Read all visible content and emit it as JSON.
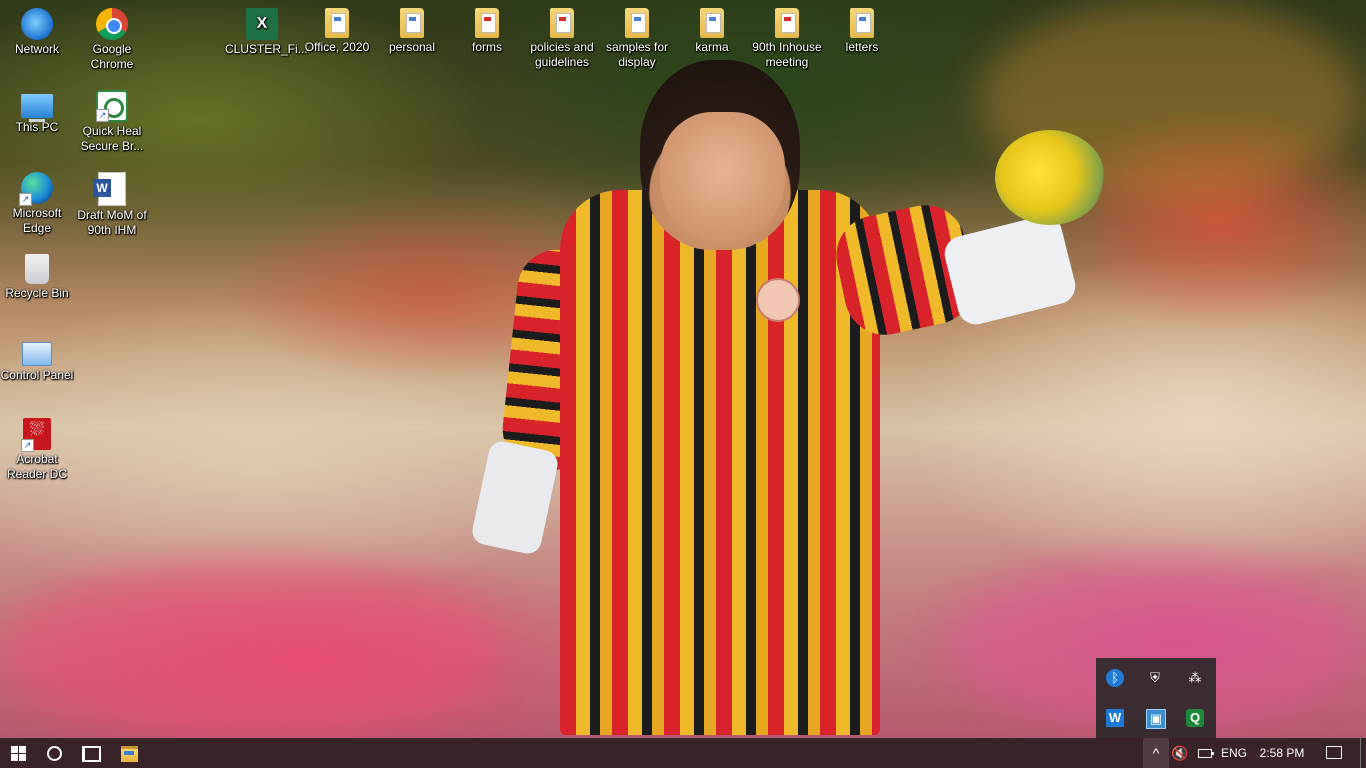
{
  "desktop": {
    "icons_left_col1": [
      {
        "label": "Network",
        "icon": "network-icon"
      },
      {
        "label": "This PC",
        "icon": "computer-icon"
      },
      {
        "label": "Microsoft Edge",
        "icon": "edge-icon"
      },
      {
        "label": "Recycle Bin",
        "icon": "recycle-bin-icon"
      },
      {
        "label": "Control Panel",
        "icon": "control-panel-icon"
      },
      {
        "label": "Acrobat Reader DC",
        "icon": "acrobat-icon"
      }
    ],
    "icons_left_col2": [
      {
        "label": "Google Chrome",
        "icon": "chrome-icon"
      },
      {
        "label": "Quick Heal Secure Br...",
        "icon": "quick-heal-icon"
      },
      {
        "label": "Draft MoM of 90th IHM",
        "icon": "word-document-icon"
      }
    ],
    "icons_top_row": [
      {
        "label": "CLUSTER_Fi...",
        "icon": "excel-file-icon"
      },
      {
        "label": "Office, 2020",
        "icon": "folder-icon"
      },
      {
        "label": "personal",
        "icon": "folder-icon"
      },
      {
        "label": "forms",
        "icon": "folder-icon"
      },
      {
        "label": "policies and guidelines",
        "icon": "folder-icon"
      },
      {
        "label": "samples for display",
        "icon": "folder-icon"
      },
      {
        "label": "karma",
        "icon": "folder-icon"
      },
      {
        "label": "90th Inhouse meeting",
        "icon": "folder-icon"
      },
      {
        "label": "letters",
        "icon": "folder-icon"
      }
    ]
  },
  "tray_popup": {
    "icons": [
      "bluetooth-icon",
      "security-shield-icon",
      "app-dots-icon",
      "w-app-icon",
      "remote-monitor-icon",
      "quick-heal-tray-icon"
    ]
  },
  "taskbar": {
    "start": "start-icon",
    "search": "search-icon",
    "task_view": "task-view-icon",
    "pinned": [
      "file-explorer-icon"
    ],
    "tray_chevron": "^",
    "volume": "🔇",
    "language": "ENG",
    "clock": "2:58 PM",
    "notifications": "notifications-icon"
  },
  "colors": {
    "taskbar_bg": "#3a2229",
    "tray_popup_bg": "#262626"
  }
}
